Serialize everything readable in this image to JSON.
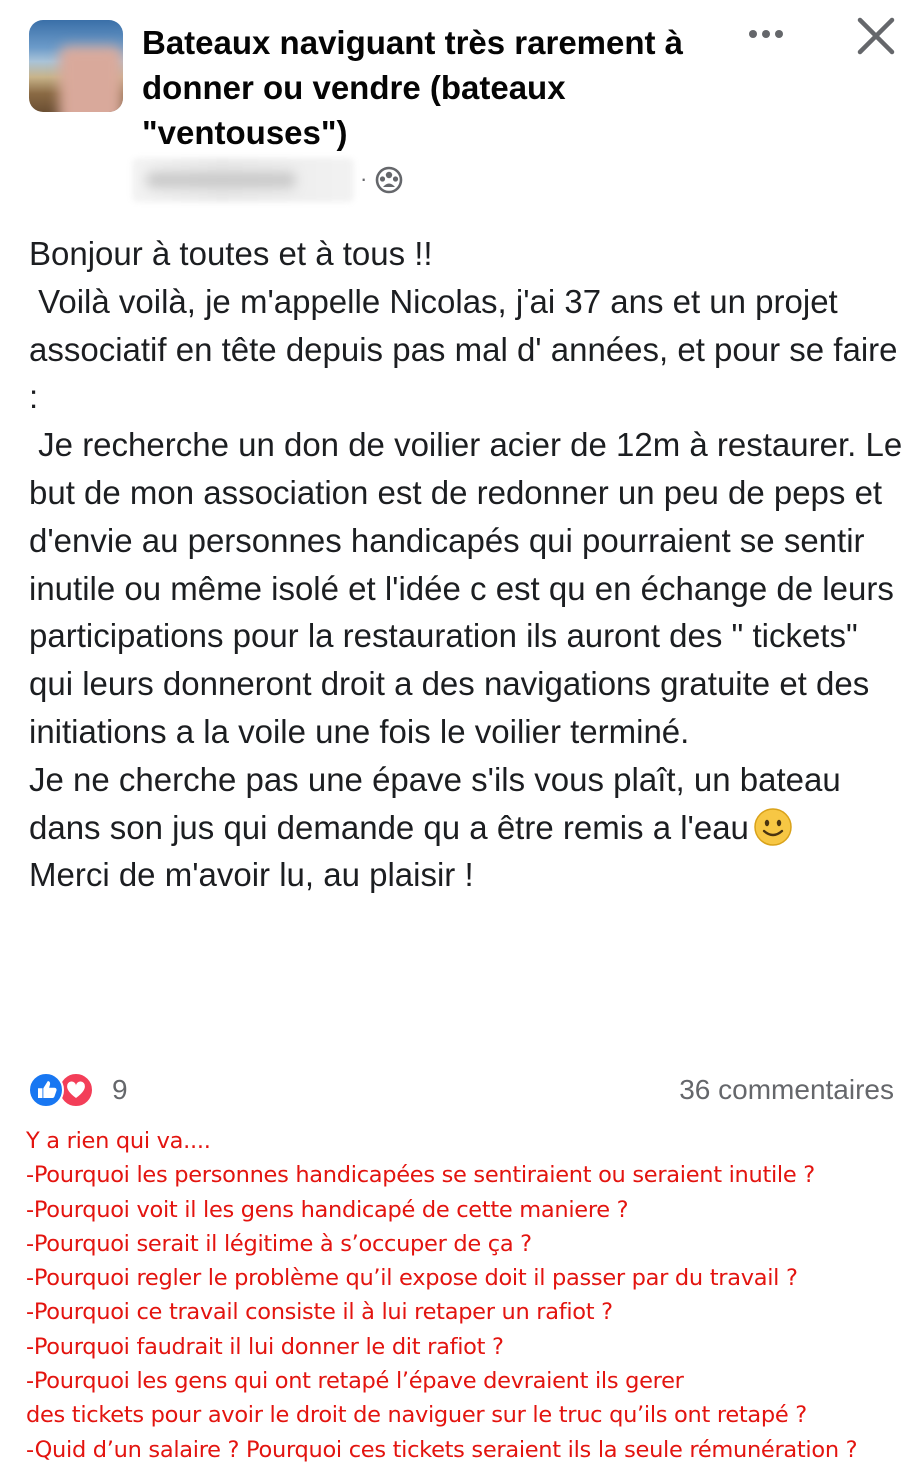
{
  "header": {
    "group_title": "Bateaux naviguant très rarement à donner ou vendre (bateaux \"ventouses\")",
    "separator": "·",
    "more_label": "•••"
  },
  "post": {
    "paragraphs": [
      "Bonjour à toutes et à tous !!",
      " Voilà voilà, je m'appelle Nicolas, j'ai 37 ans et un projet associatif en tête depuis pas mal d' années, et pour se faire :",
      " Je recherche un don de voilier acier de 12m à restaurer. Le but de mon association est de redonner un peu de peps et d'envie au personnes handicapés qui pourraient se sentir inutile ou même isolé et l'idée c est qu en échange de leurs participations pour la restauration ils auront des \" tickets\" qui leurs donneront droit a des navigations gratuite et des initiations a la voile une fois le voilier terminé.",
      "Je ne cherche pas une épave s'ils vous plaît, un bateau dans son jus qui demande qu a être remis a l'eau",
      "Merci de m'avoir lu, au plaisir !"
    ]
  },
  "reactions": {
    "count": "9",
    "comments": "36 commentaires"
  },
  "annotation": {
    "lines": [
      "Y a rien qui va....",
      "-Pourquoi les personnes handicapées se sentiraient ou seraient inutile ?",
      "-Pourquoi voit il les gens handicapé de cette maniere ?",
      "-Pourquoi serait il légitime à s’occuper de ça ?",
      "-Pourquoi regler le problème qu’il expose doit il passer par du travail ?",
      "-Pourquoi ce travail consiste il à lui retaper un rafiot ?",
      "-Pourquoi faudrait il lui donner le dit rafiot ?",
      "-Pourquoi les gens qui ont retapé l’épave devraient ils gerer",
      "des tickets pour avoir le droit de naviguer sur le truc qu’ils ont retapé ?",
      "-Quid d’un salaire ? Pourquoi ces tickets seraient ils la seule rémunération ?"
    ]
  },
  "icons": {
    "group": "group-icon",
    "more": "more-icon",
    "close": "close-icon",
    "like": "like-icon",
    "love": "love-icon",
    "emoji": "smiley-emoji-icon"
  },
  "colors": {
    "annotation": "#e3140f",
    "like": "#1877f2",
    "love": "#f33e58",
    "secondary_text": "#65676b"
  }
}
